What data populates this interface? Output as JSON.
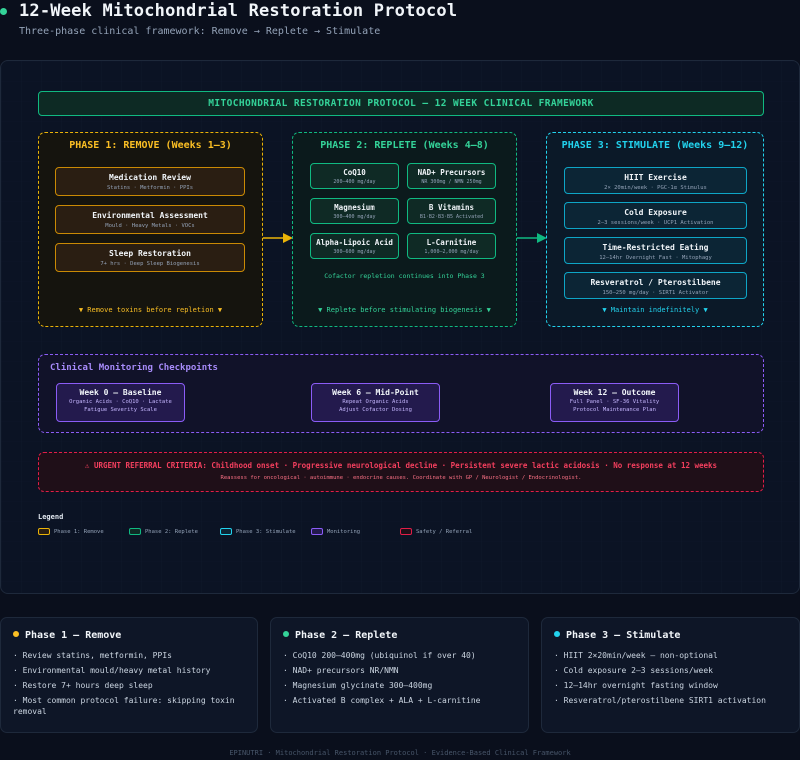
{
  "header": {
    "title": "12-Week Mitochondrial Restoration Protocol",
    "subtitle": "Three-phase clinical framework: Remove → Replete → Stimulate"
  },
  "diagram": {
    "banner": "MITOCHONDRIAL RESTORATION PROTOCOL — 12 WEEK CLINICAL FRAMEWORK",
    "phase1": {
      "title": "PHASE 1: REMOVE (Weeks 1–3)",
      "items": [
        {
          "title": "Medication Review",
          "sub": "Statins · Metformin · PPIs"
        },
        {
          "title": "Environmental Assessment",
          "sub": "Mould · Heavy Metals · VOCs"
        },
        {
          "title": "Sleep Restoration",
          "sub": "7+ hrs · Deep Sleep Biogenesis"
        }
      ],
      "footer": "▼ Remove toxins before repletion ▼"
    },
    "phase2": {
      "title": "PHASE 2: REPLETE (Weeks 4–8)",
      "items": [
        {
          "title": "CoQ10",
          "sub": "200–400 mg/day"
        },
        {
          "title": "NAD+ Precursors",
          "sub": "NR 300mg / NMN 250mg"
        },
        {
          "title": "Magnesium",
          "sub": "300–400 mg/day"
        },
        {
          "title": "B Vitamins",
          "sub": "B1·B2·B3·B5 Activated"
        },
        {
          "title": "Alpha-Lipoic Acid",
          "sub": "300–600 mg/day"
        },
        {
          "title": "L-Carnitine",
          "sub": "1,000–2,000 mg/day"
        }
      ],
      "note": "Cofactor repletion continues into Phase 3",
      "footer": "▼ Replete before stimulating biogenesis ▼"
    },
    "phase3": {
      "title": "PHASE 3: STIMULATE (Weeks 9–12)",
      "items": [
        {
          "title": "HIIT Exercise",
          "sub": "2× 20min/week · PGC-1α Stimulus"
        },
        {
          "title": "Cold Exposure",
          "sub": "2–3 sessions/week · UCP1 Activation"
        },
        {
          "title": "Time-Restricted Eating",
          "sub": "12–14hr Overnight Fast · Mitophagy"
        },
        {
          "title": "Resveratrol / Pterostilbene",
          "sub": "150–250 mg/day · SIRT1 Activator"
        }
      ],
      "footer": "▼ Maintain indefinitely ▼"
    },
    "monitoring": {
      "title": "Clinical Monitoring Checkpoints",
      "checkpoints": [
        {
          "title": "Week 0 — Baseline",
          "line1": "Organic Acids · CoQ10 · Lactate",
          "line2": "Fatigue Severity Scale"
        },
        {
          "title": "Week 6 — Mid-Point",
          "line1": "Repeat Organic Acids",
          "line2": "Adjust Cofactor Dosing"
        },
        {
          "title": "Week 12 — Outcome",
          "line1": "Full Panel · SF-36 Vitality",
          "line2": "Protocol Maintenance Plan"
        }
      ]
    },
    "urgent": {
      "line1": "⚠ URGENT REFERRAL CRITERIA: Childhood onset · Progressive neurological decline · Persistent severe lactic acidosis · No response at 12 weeks",
      "line2": "Reassess for oncological · autoimmune · endocrine causes. Coordinate with GP / Neurologist / Endocrinologist."
    },
    "legend": {
      "title": "Legend",
      "items": [
        {
          "label": "Phase 1: Remove",
          "color": "#eab308"
        },
        {
          "label": "Phase 2: Replete",
          "color": "#10b981"
        },
        {
          "label": "Phase 3: Stimulate",
          "color": "#22d3ee"
        },
        {
          "label": "Monitoring",
          "color": "#8b5cf6"
        },
        {
          "label": "Safety / Referral",
          "color": "#e11d48"
        }
      ]
    }
  },
  "cards": [
    {
      "title": "Phase 1 — Remove",
      "dot_color": "#fbbf24",
      "items": [
        "Review statins, metformin, PPIs",
        "Environmental mould/heavy metal history",
        "Restore 7+ hours deep sleep",
        "Most common protocol failure: skipping toxin removal"
      ]
    },
    {
      "title": "Phase 2 — Replete",
      "dot_color": "#34d399",
      "items": [
        "CoQ10 200–400mg (ubiquinol if over 40)",
        "NAD+ precursors NR/NMN",
        "Magnesium glycinate 300–400mg",
        "Activated B complex + ALA + L-carnitine"
      ]
    },
    {
      "title": "Phase 3 — Stimulate",
      "dot_color": "#22d3ee",
      "items": [
        "HIIT 2×20min/week — non-optional",
        "Cold exposure 2–3 sessions/week",
        "12–14hr overnight fasting window",
        "Resveratrol/pterostilbene SIRT1 activation"
      ]
    }
  ],
  "footer": "EPINUTRI · Mitochondrial Restoration Protocol · Evidence-Based Clinical Framework"
}
